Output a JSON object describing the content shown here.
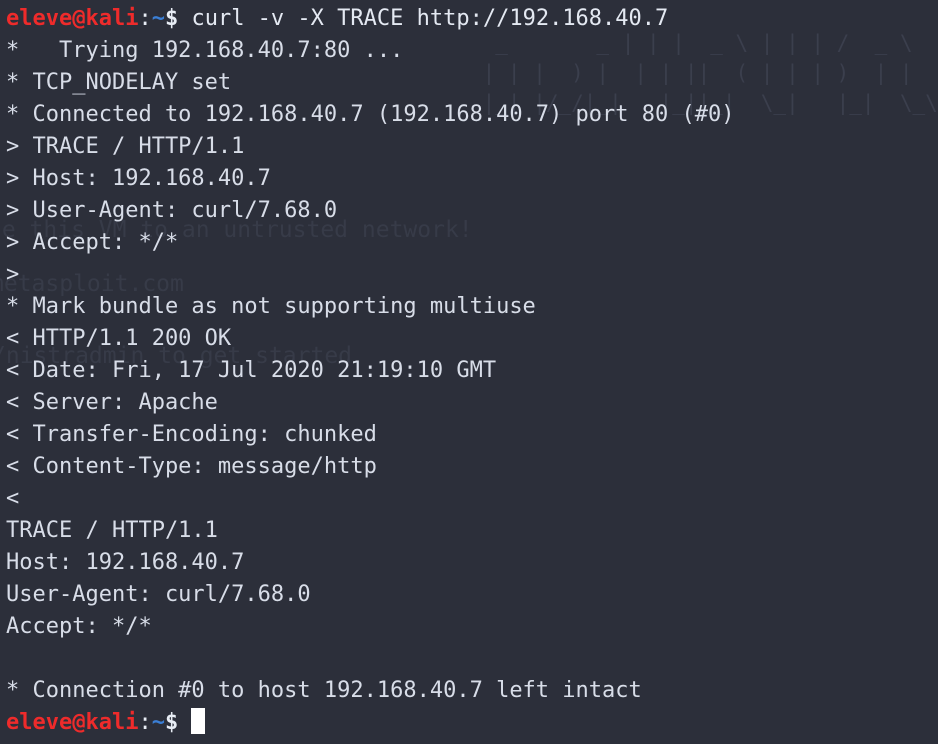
{
  "terminal": {
    "background_color": "#2c2f3a",
    "foreground_color": "#d8dde8",
    "prompt_user_color": "#ee2b2b",
    "prompt_path_color": "#3b7fd6",
    "cursor_color": "#ffffff",
    "prompt": {
      "user_host": "eleve@kali",
      "colon": ":",
      "path": "~",
      "dollar": "$"
    },
    "command": "curl -v -X TRACE http://192.168.40.7",
    "output_lines": [
      "*   Trying 192.168.40.7:80 ...",
      "* TCP_NODELAY set",
      "* Connected to 192.168.40.7 (192.168.40.7) port 80 (#0)",
      "> TRACE / HTTP/1.1",
      "> Host: 192.168.40.7",
      "> User-Agent: curl/7.68.0",
      "> Accept: */*",
      ">",
      "* Mark bundle as not supporting multiuse",
      "< HTTP/1.1 200 OK",
      "< Date: Fri, 17 Jul 2020 21:19:10 GMT",
      "< Server: Apache",
      "< Transfer-Encoding: chunked",
      "< Content-Type: message/http",
      "<",
      "TRACE / HTTP/1.1",
      "Host: 192.168.40.7",
      "User-Agent: curl/7.68.0",
      "Accept: */*",
      "",
      "* Connection #0 to host 192.168.40.7 left intact"
    ]
  },
  "wallpaper": {
    "warning_text": "se this VM to an untrusted network!",
    "site_text": "metasploit.com",
    "hint_text": "/nistradmin to get started",
    "ascii_art": [
      "  _       _ | | |  _ \\ | | | /  _ \\  )  |",
      " | | |  ) |  | | ||  ( | | | )  | |  // /",
      " |_| |/_/|_|   |_||_|  \\_|   |_|  \\_\\  | |"
    ]
  }
}
